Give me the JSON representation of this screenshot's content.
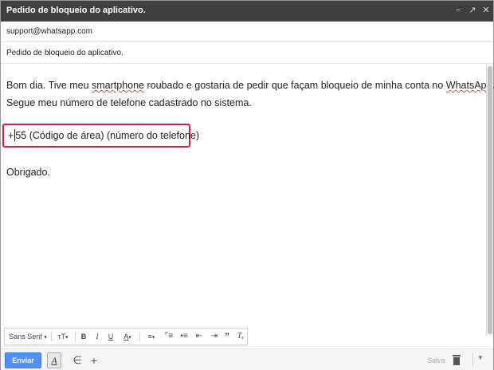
{
  "window": {
    "title": "Pedido de bloqueio do aplicativo.",
    "controls": [
      "minimize-icon",
      "expand-icon",
      "close-icon"
    ]
  },
  "compose": {
    "to": "support@whatsapp.com",
    "subject": "Pedido de bloqueio do aplicativo.",
    "body": {
      "line1_a": "Bom dia. Tive meu ",
      "line1_b": "smartphone",
      "line1_c": " roubado e gostaria de pedir que façam bloqueio de minha conta no ",
      "line1_d": "WhatsApp",
      "line1_e": ".",
      "line2": "Segue meu número de telefone cadastrado no sistema.",
      "phone_prefix": "+",
      "phone_rest": "55 (Código de área) (número do telefone)",
      "closing": "Obrigado."
    }
  },
  "toolbar": {
    "font": "Sans Serif",
    "size_glyph": "тT",
    "bold": "B",
    "italic": "I",
    "underline": "U",
    "text_color": "A",
    "icons": [
      "align-icon",
      "numbered-list-icon",
      "bulleted-list-icon",
      "indent-less-icon",
      "indent-more-icon",
      "quote-icon",
      "remove-formatting-icon"
    ]
  },
  "bottom": {
    "send_label": "Enviar",
    "format_label": "A",
    "attach_icon": "paperclip-icon",
    "more_icon": "plus-icon",
    "saved_label": "Salva",
    "trash_icon": "trash-icon",
    "options_icon": "chevron-down-icon"
  },
  "colors": {
    "titlebar": "#404040",
    "send": "#4d90fe",
    "highlight": "#e8173e",
    "misspell": "#dd4b39"
  }
}
